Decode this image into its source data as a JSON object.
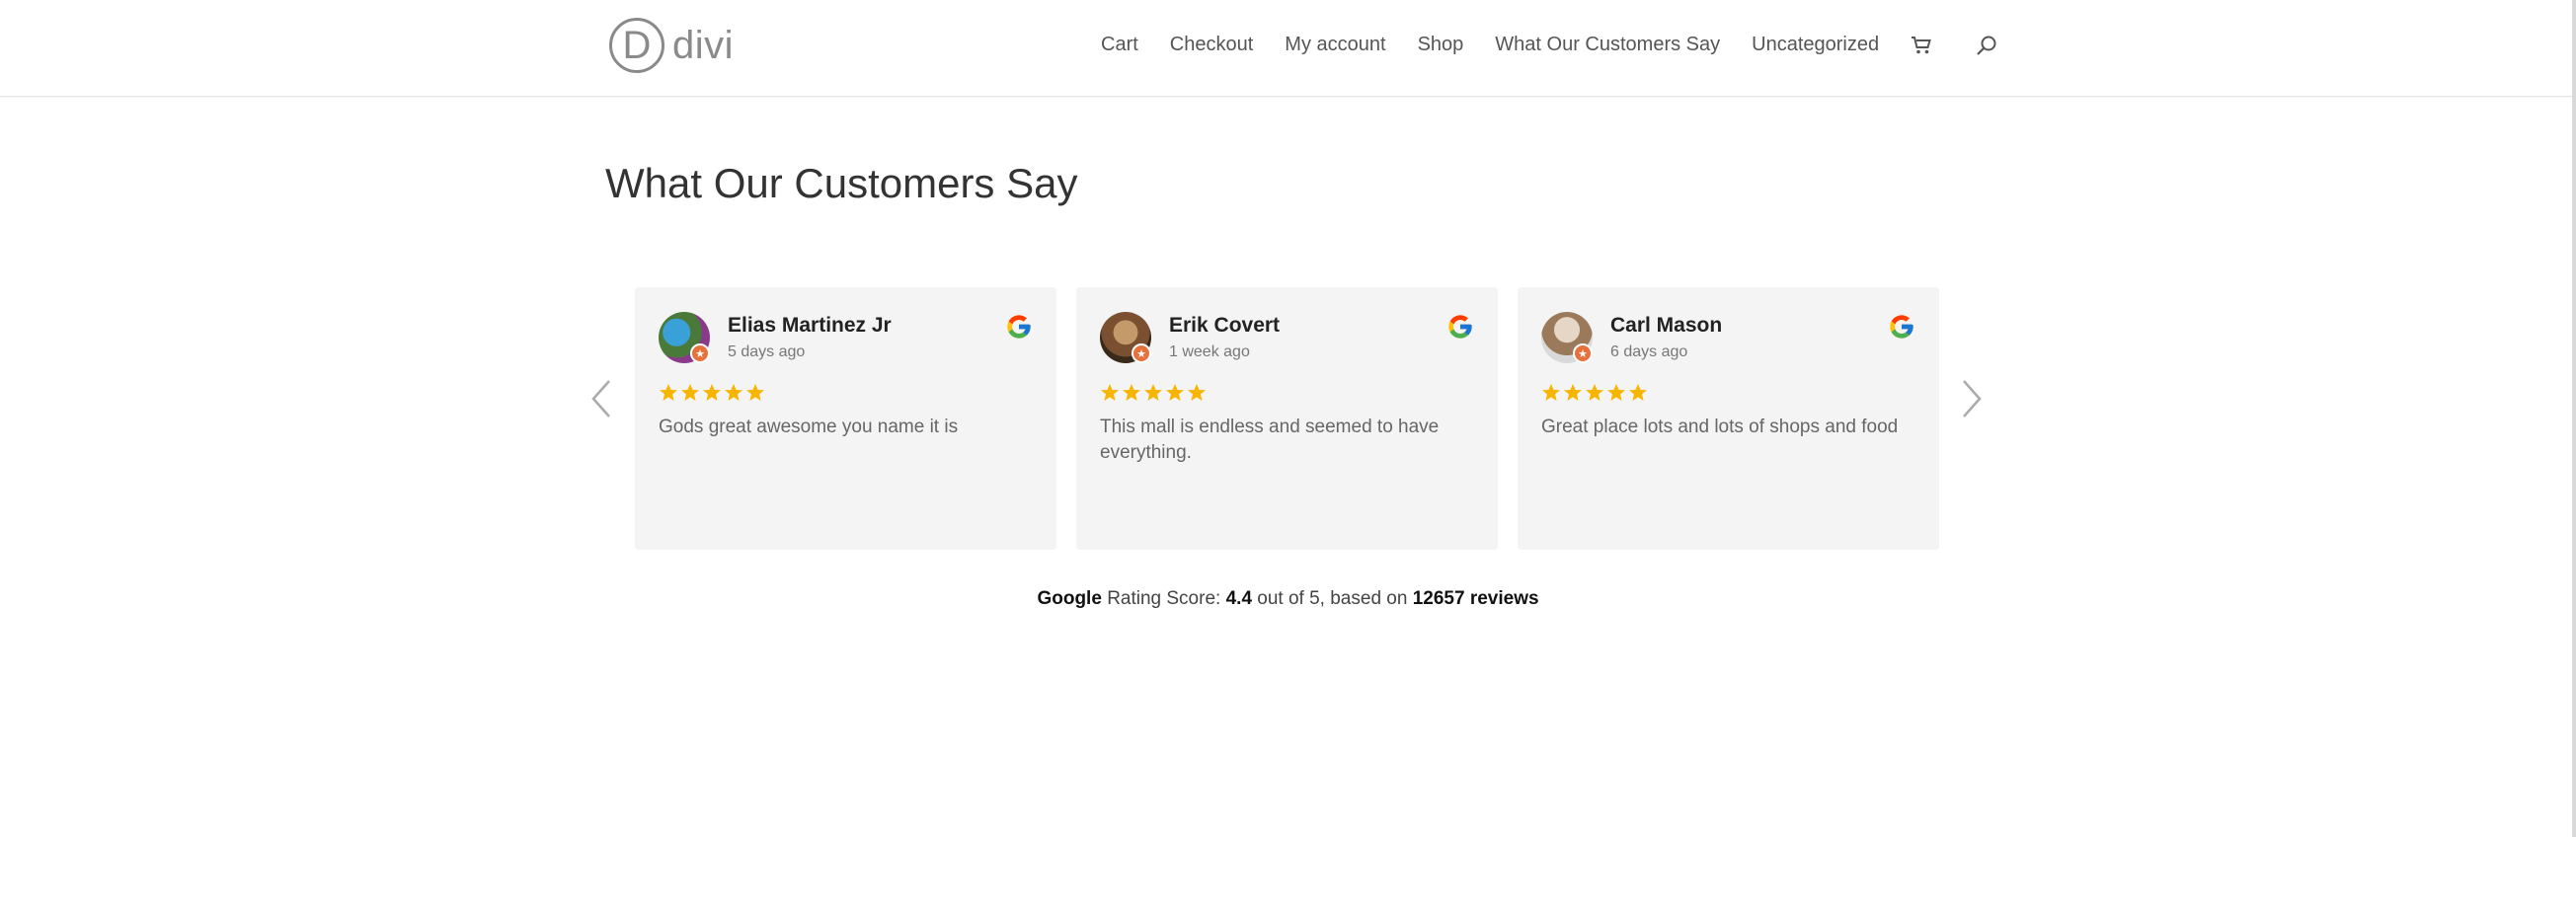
{
  "site": {
    "logo_letter": "D",
    "logo_text": "divi"
  },
  "nav": {
    "items": [
      "Cart",
      "Checkout",
      "My account",
      "Shop",
      "What Our Customers Say",
      "Uncategorized"
    ],
    "cart_icon": "cart-icon",
    "search_icon": "search-icon"
  },
  "page": {
    "title": "What Our Customers Say"
  },
  "reviews": [
    {
      "name": "Elias Martinez Jr",
      "time": "5 days ago",
      "rating": 5,
      "text": "Gods great awesome you name it is",
      "source_icon": "google-icon"
    },
    {
      "name": "Erik Covert",
      "time": "1 week ago",
      "rating": 5,
      "text": "This mall is endless and seemed to have everything.",
      "source_icon": "google-icon"
    },
    {
      "name": "Carl Mason",
      "time": "6 days ago",
      "rating": 5,
      "text": "Great place lots and lots of shops and food",
      "source_icon": "google-icon"
    }
  ],
  "summary": {
    "brand": "Google",
    "label": "Rating Score:",
    "score": "4.4",
    "out_of": "out of 5, based on",
    "count": "12657 reviews"
  },
  "colors": {
    "star": "#f7b500",
    "card_bg": "#f4f4f4",
    "badge": "#e8703a"
  }
}
